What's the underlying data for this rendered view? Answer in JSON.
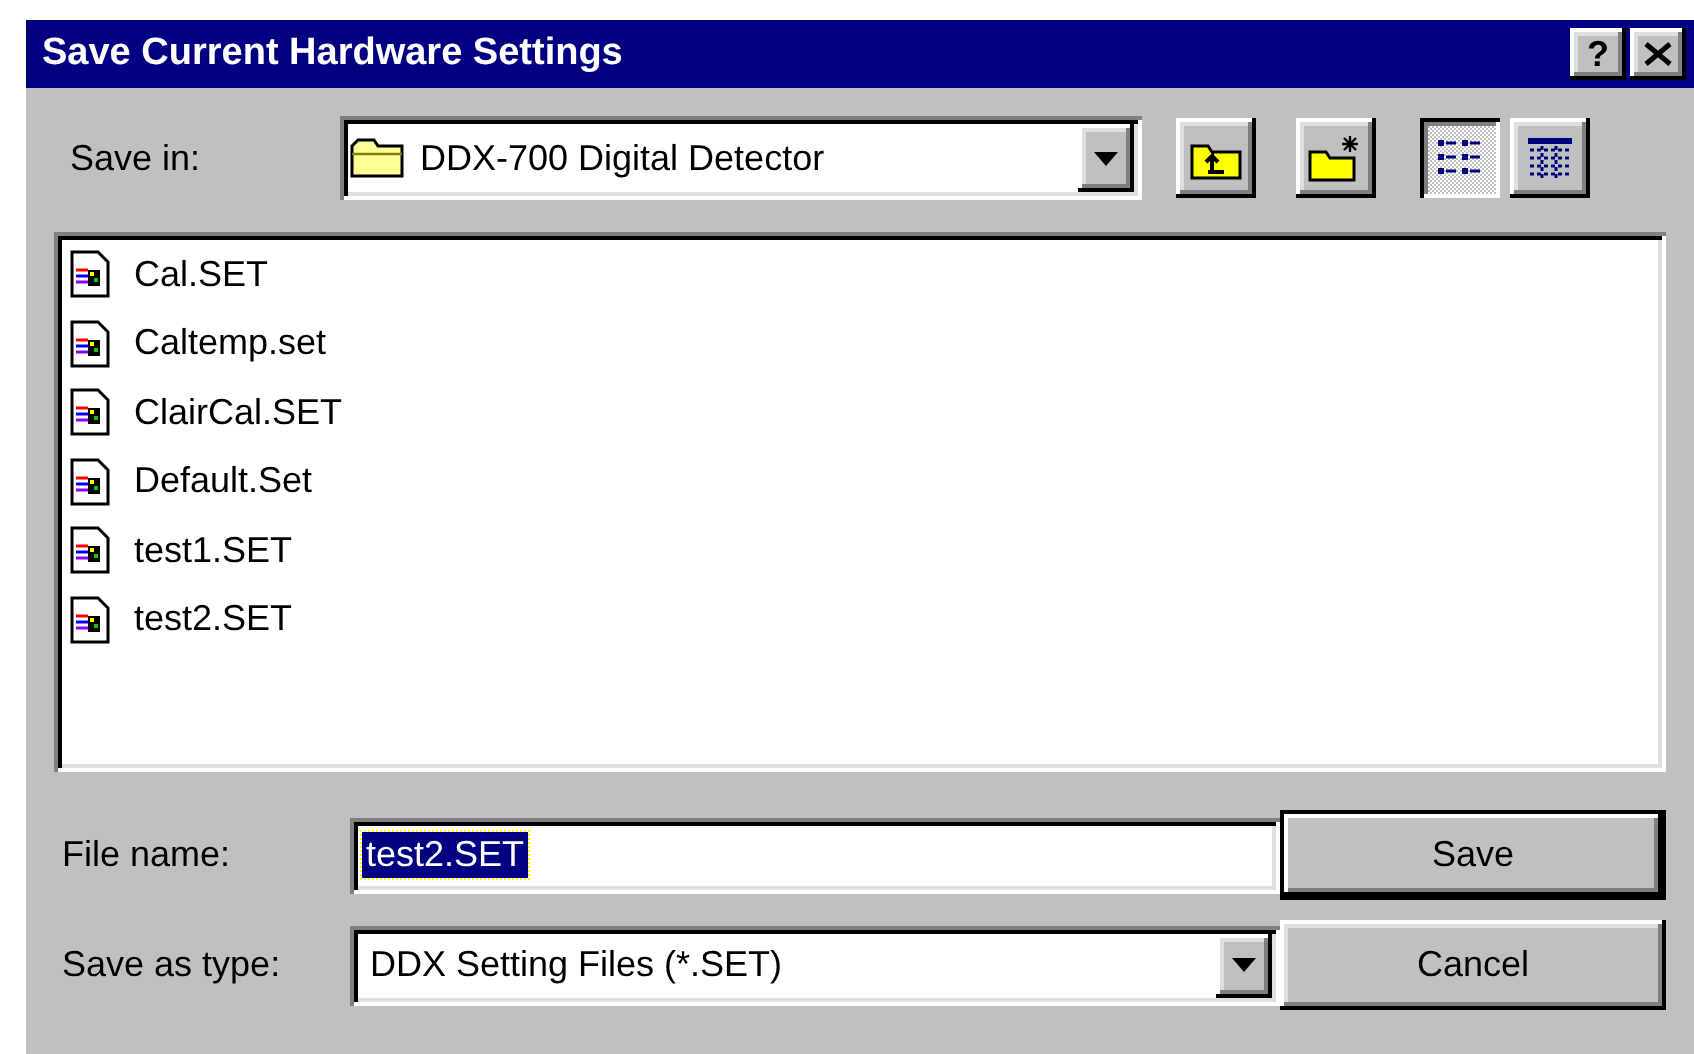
{
  "window": {
    "title": "Save Current Hardware Settings",
    "help_button": "?"
  },
  "save_in": {
    "label": "Save in:",
    "value": "DDX-700 Digital Detector"
  },
  "toolbar": [
    {
      "kind": "up-folder",
      "pressed": false
    },
    {
      "kind": "new-folder",
      "pressed": false
    },
    {
      "kind": "list-view",
      "pressed": true
    },
    {
      "kind": "details-view",
      "pressed": false
    }
  ],
  "files": [
    {
      "name": "Cal.SET"
    },
    {
      "name": "Caltemp.set"
    },
    {
      "name": "ClairCal.SET"
    },
    {
      "name": "Default.Set"
    },
    {
      "name": "test1.SET"
    },
    {
      "name": "test2.SET"
    }
  ],
  "file_name": {
    "label": "File name:",
    "value": "test2.SET",
    "highlighted": true
  },
  "save_as_type": {
    "label": "Save as type:",
    "value": "DDX Setting Files (*.SET)"
  },
  "buttons": [
    {
      "label": "Save",
      "default": true
    },
    {
      "label": "Cancel",
      "default": false
    }
  ]
}
